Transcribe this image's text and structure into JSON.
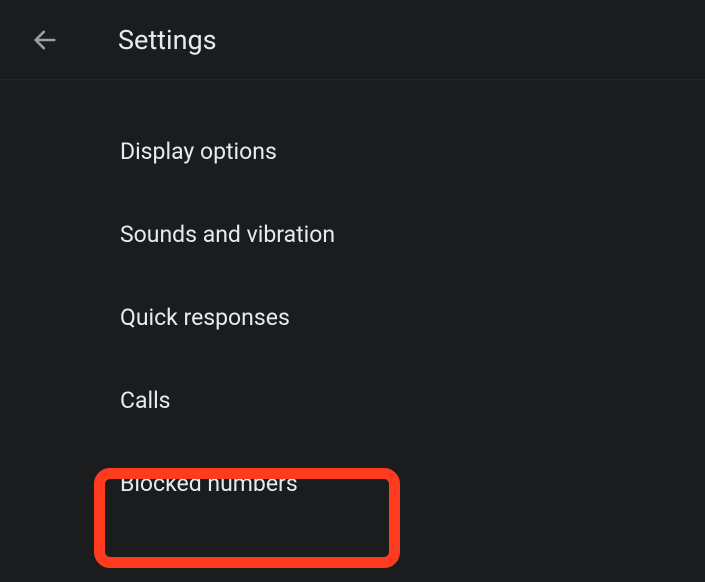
{
  "header": {
    "title": "Settings"
  },
  "settings": {
    "items": [
      {
        "label": "Display options"
      },
      {
        "label": "Sounds and vibration"
      },
      {
        "label": "Quick responses"
      },
      {
        "label": "Calls"
      },
      {
        "label": "Blocked numbers"
      }
    ]
  },
  "highlight": {
    "target_index": 4
  }
}
